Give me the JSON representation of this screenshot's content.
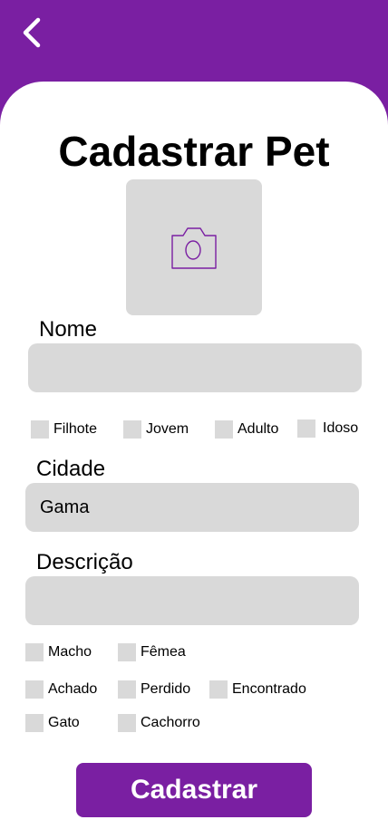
{
  "header": {
    "back_icon": "chevron-left-icon",
    "color": "#7a1fa2"
  },
  "title": "Cadastrar Pet",
  "photo": {
    "icon": "camera-icon"
  },
  "name": {
    "label": "Nome",
    "value": ""
  },
  "age_options": [
    "Filhote",
    "Jovem",
    "Adulto",
    "Idoso"
  ],
  "city": {
    "label": "Cidade",
    "value": "Gama"
  },
  "description": {
    "label": "Descrição",
    "value": ""
  },
  "sex_options": [
    "Macho",
    "Fêmea"
  ],
  "status_options": [
    "Achado",
    "Perdido",
    "Encontrado"
  ],
  "species_options": [
    "Gato",
    "Cachorro"
  ],
  "submit_label": "Cadastrar"
}
